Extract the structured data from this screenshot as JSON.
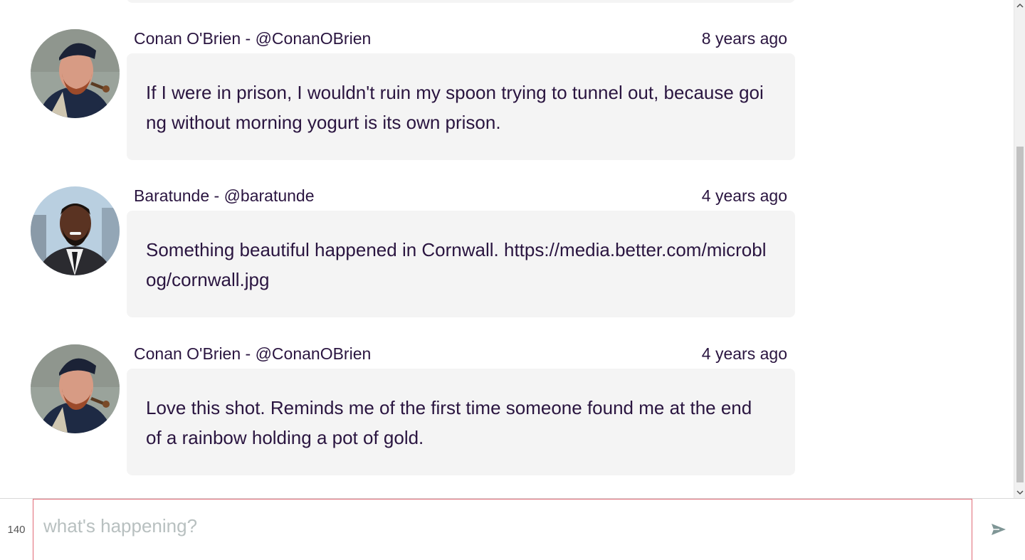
{
  "feed": {
    "posts": [
      {
        "author": "Conan O'Brien - @ConanOBrien",
        "time": "8 years ago",
        "text": "If I were in prison, I wouldn't ruin my spoon trying to tunnel out, because going without morning yogurt is its own prison.",
        "avatar": "conan-avatar"
      },
      {
        "author": "Baratunde - @baratunde",
        "time": "4 years ago",
        "text": "Something beautiful happened in Cornwall. https://media.better.com/microblog/cornwall.jpg",
        "avatar": "baratunde-avatar"
      },
      {
        "author": "Conan O'Brien - @ConanOBrien",
        "time": "4 years ago",
        "text": "Love this shot. Reminds me of the first time someone found me at the end of a rainbow holding a pot of gold.",
        "avatar": "conan-avatar"
      }
    ]
  },
  "composer": {
    "char_count": "140",
    "placeholder": "what's happening?",
    "value": "",
    "send_icon": "send-icon"
  },
  "colors": {
    "text": "#2a1540",
    "bubble": "#f4f4f4",
    "input_border": "#e06a76",
    "placeholder": "#b8c0c0"
  }
}
